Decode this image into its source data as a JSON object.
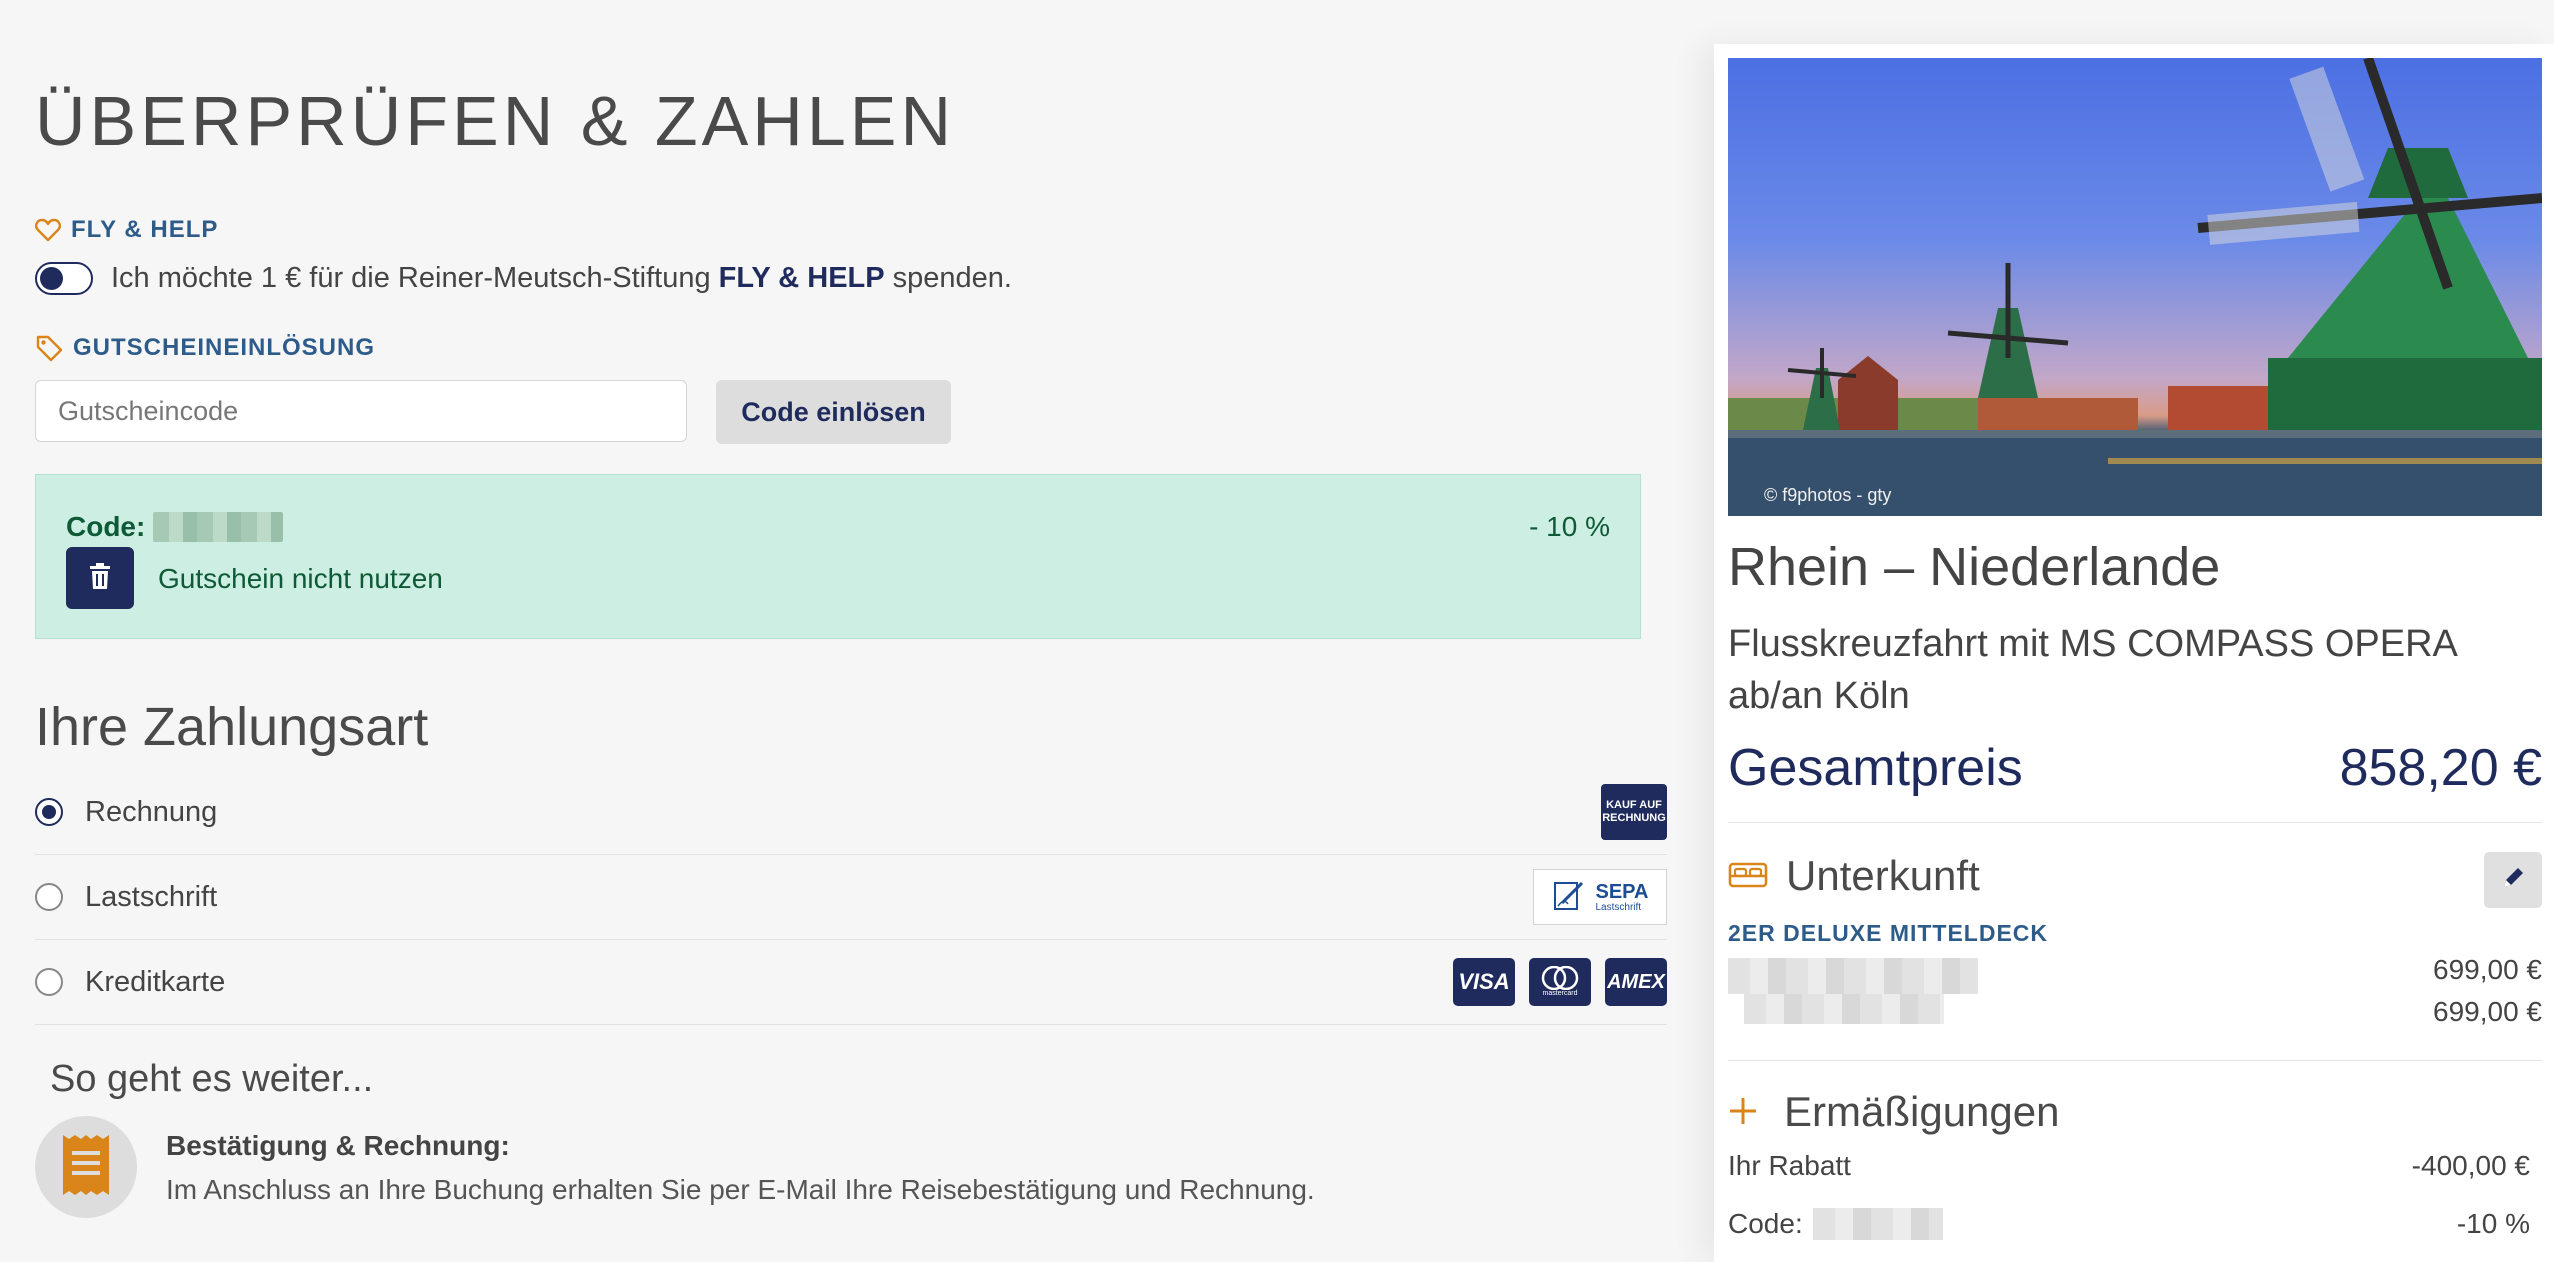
{
  "page": {
    "title": "ÜBERPRÜFEN & ZAHLEN"
  },
  "fly_help": {
    "heading": "FLY & HELP",
    "text_before": "Ich möchte 1 € für die Reiner-Meutsch-Stiftung",
    "text_bold": "FLY & HELP",
    "text_after": "spenden.",
    "toggle_on": false
  },
  "voucher": {
    "heading": "GUTSCHEINEINLÖSUNG",
    "input_placeholder": "Gutscheincode",
    "input_value": "",
    "submit_label": "Code einlösen",
    "applied": {
      "code_label": "Code:",
      "discount": "- 10 %",
      "remove_label": "Gutschein nicht nutzen"
    }
  },
  "payment": {
    "title": "Ihre Zahlungsart",
    "options": [
      {
        "label": "Rechnung",
        "selected": true,
        "logos": [
          "KAUF AUF RECHNUNG"
        ]
      },
      {
        "label": "Lastschrift",
        "selected": false,
        "logos": [
          "SEPA",
          "Lastschrift"
        ]
      },
      {
        "label": "Kreditkarte",
        "selected": false,
        "logos": [
          "VISA",
          "mastercard",
          "AMEX"
        ]
      }
    ]
  },
  "next_steps": {
    "title": "So geht es weiter...",
    "item_heading": "Bestätigung & Rechnung:",
    "item_text": "Im Anschluss an Ihre Buchung erhalten Sie per E-Mail Ihre Reisebestätigung und Rechnung."
  },
  "summary": {
    "image_credit": "© f9photos - gty",
    "trip_title": "Rhein – Niederlande",
    "trip_subtitle": "Flusskreuzfahrt mit MS COMPASS OPERA ab/an Köln",
    "total_label": "Gesamtpreis",
    "total_value": "858,20 €",
    "accommodation": {
      "heading": "Unterkunft",
      "cabin": "2ER DELUXE MITTELDECK",
      "price_1": "699,00 €",
      "price_2": "699,00 €"
    },
    "discounts": {
      "heading": "Ermäßigungen",
      "rabatt_label": "Ihr Rabatt",
      "rabatt_value": "-400,00 €",
      "code_label": "Code:",
      "code_value": "-10 %"
    }
  },
  "colors": {
    "brand_navy": "#1f2b5c",
    "link_blue": "#2e5c8a",
    "accent_orange": "#d9851a",
    "success_bg": "#cdeee2",
    "success_text": "#0e5a36"
  }
}
